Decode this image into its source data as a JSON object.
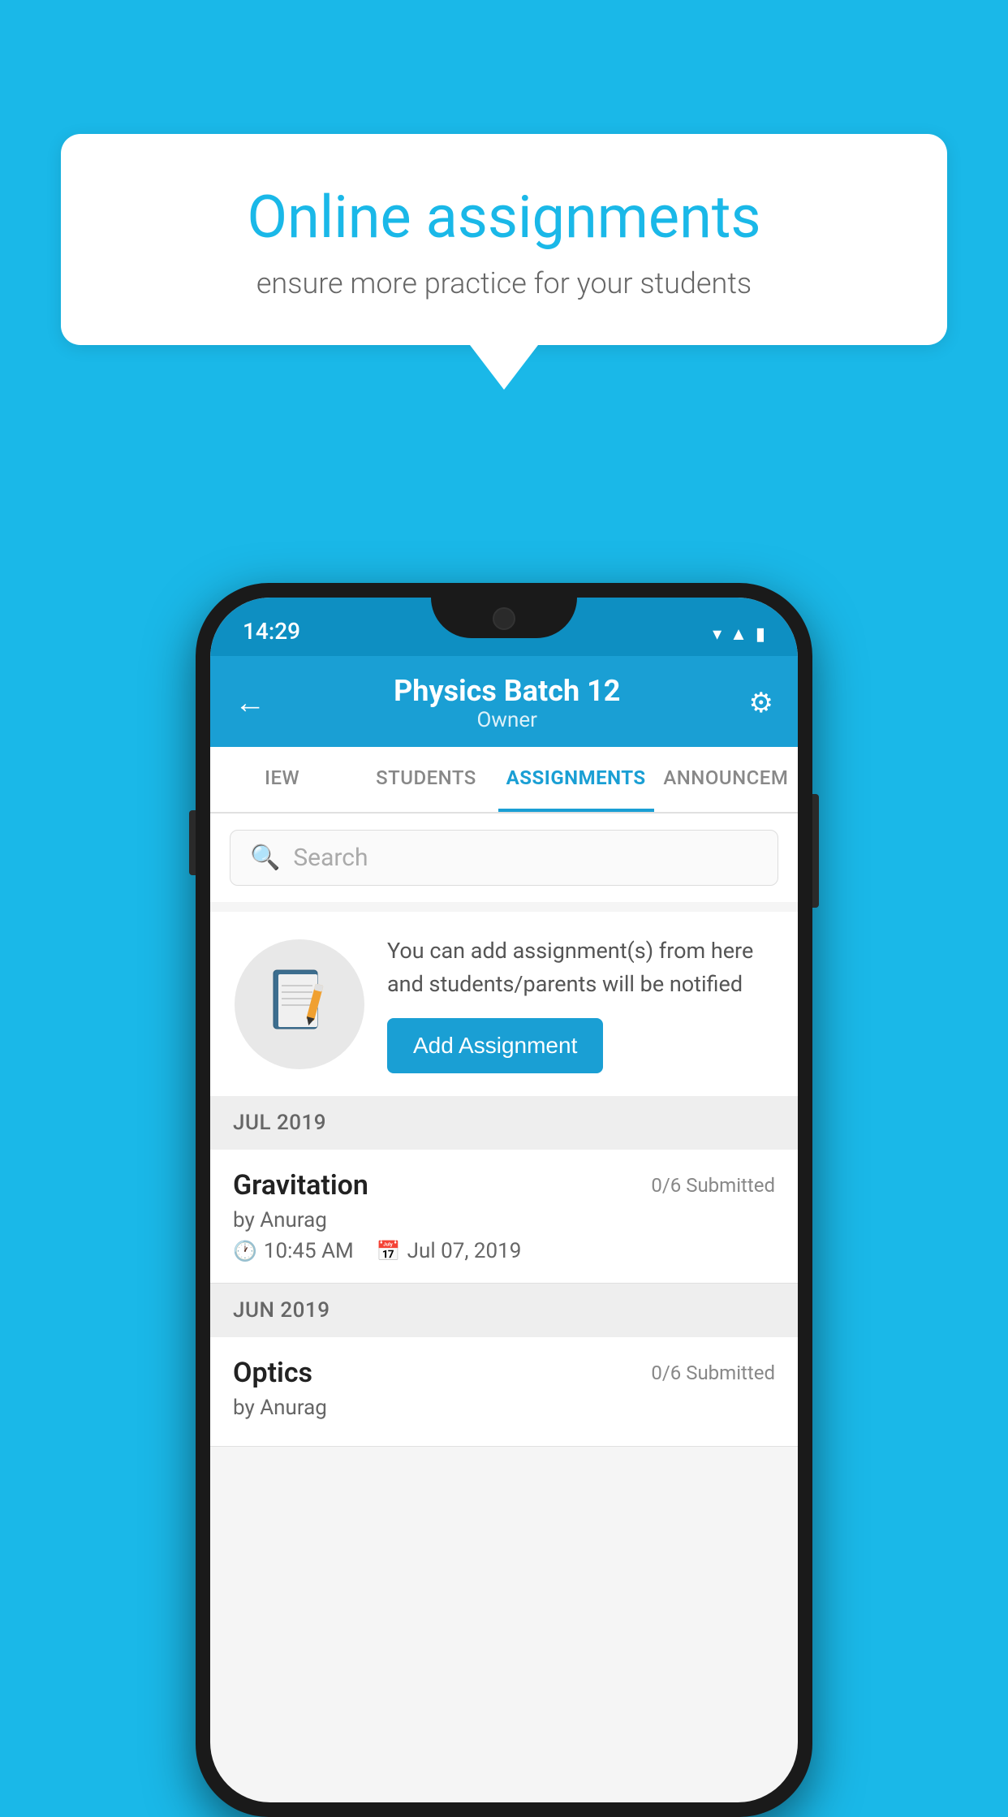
{
  "background_color": "#1ab8e8",
  "speech_bubble": {
    "title": "Online assignments",
    "subtitle": "ensure more practice for your students"
  },
  "status_bar": {
    "time": "14:29",
    "icons": [
      "wifi",
      "signal",
      "battery"
    ]
  },
  "header": {
    "title": "Physics Batch 12",
    "subtitle": "Owner",
    "back_label": "←",
    "settings_label": "⚙"
  },
  "tabs": [
    {
      "label": "IEW",
      "active": false
    },
    {
      "label": "STUDENTS",
      "active": false
    },
    {
      "label": "ASSIGNMENTS",
      "active": true
    },
    {
      "label": "ANNOUNCEM",
      "active": false
    }
  ],
  "search": {
    "placeholder": "Search"
  },
  "info_card": {
    "description": "You can add assignment(s) from here and students/parents will be notified",
    "button_label": "Add Assignment"
  },
  "sections": [
    {
      "label": "JUL 2019",
      "assignments": [
        {
          "name": "Gravitation",
          "submitted": "0/6 Submitted",
          "author": "by Anurag",
          "time": "10:45 AM",
          "date": "Jul 07, 2019"
        }
      ]
    },
    {
      "label": "JUN 2019",
      "assignments": [
        {
          "name": "Optics",
          "submitted": "0/6 Submitted",
          "author": "by Anurag",
          "time": "",
          "date": ""
        }
      ]
    }
  ]
}
